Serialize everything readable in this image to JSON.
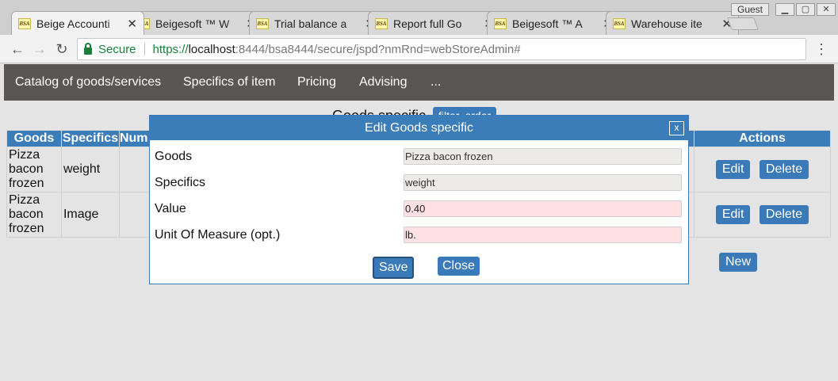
{
  "browser": {
    "tabs": [
      {
        "title": "Beige Accounti",
        "active": true
      },
      {
        "title": "Beigesoft ™ W",
        "active": false
      },
      {
        "title": "Trial balance a",
        "active": false
      },
      {
        "title": "Report full Go",
        "active": false
      },
      {
        "title": "Beigesoft ™ A",
        "active": false
      },
      {
        "title": "Warehouse ite",
        "active": false
      }
    ],
    "favicon_text": "BSA",
    "guest_label": "Guest",
    "secure_label": "Secure",
    "url": {
      "scheme": "https://",
      "host": "localhost",
      "rest": ":8444/bsa8444/secure/jspd?nmRnd=webStoreAdmin#"
    }
  },
  "nav": {
    "items": [
      "Catalog of goods/services",
      "Specifics of item",
      "Pricing",
      "Advising",
      "..."
    ]
  },
  "list": {
    "title": "Goods specific",
    "filter_order_label": "filter, order",
    "columns": [
      "Goods",
      "Specifics",
      "Num",
      "Actions"
    ],
    "rows": [
      {
        "goods": "Pizza bacon frozen",
        "specifics": "weight"
      },
      {
        "goods": "Pizza bacon frozen",
        "specifics": "Image"
      }
    ],
    "edit_label": "Edit",
    "delete_label": "Delete",
    "new_label": "New"
  },
  "modal": {
    "title": "Edit Goods specific",
    "close_x": "x",
    "fields": [
      {
        "label": "Goods",
        "value": "Pizza bacon frozen"
      },
      {
        "label": "Specifics",
        "value": "weight"
      },
      {
        "label": "Value",
        "value": "0.40"
      },
      {
        "label": "Unit Of Measure (opt.)",
        "value": "lb."
      }
    ],
    "save_label": "Save",
    "close_label": "Close"
  },
  "colors": {
    "accent": "#3b7db9",
    "nav_bg": "#5a5654",
    "required_field": "#ffe1e4",
    "readonly_field": "#ecebe7"
  }
}
